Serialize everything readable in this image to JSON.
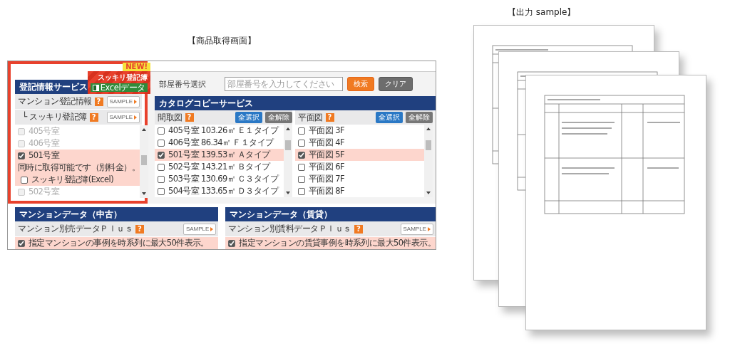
{
  "screen_caption": "【商品取得画面】",
  "output_caption": "【出力 sample】",
  "badge": {
    "new": "NEW!",
    "title": "スッキリ登記簿",
    "tag": "Excelデータ"
  },
  "registry": {
    "title": "登記情報サービス",
    "services": [
      {
        "label": "マンション登記情報",
        "help": "?",
        "sample": "SAMPLE"
      },
      {
        "label": "└ スッキリ登記簿",
        "help": "?",
        "sample": "SAMPLE"
      }
    ],
    "rooms": [
      {
        "kind": "room",
        "label": "405号室",
        "checked": false,
        "disabled": true
      },
      {
        "kind": "room",
        "label": "406号室",
        "checked": false,
        "disabled": true
      },
      {
        "kind": "room",
        "label": "501号室",
        "checked": true,
        "disabled": false
      },
      {
        "kind": "note",
        "label": "同時に取得可能です（別料金）。"
      },
      {
        "kind": "option",
        "label": "スッキリ登記簿(Excel)",
        "checked": false,
        "disabled": false
      },
      {
        "kind": "room",
        "label": "502号室",
        "checked": false,
        "disabled": true
      }
    ]
  },
  "room_search": {
    "label": "部屋番号選択",
    "placeholder": "部屋番号を入力してください",
    "buttons": [
      {
        "kind": "primary",
        "label": "検索"
      },
      {
        "kind": "secondary",
        "label": "クリア"
      }
    ]
  },
  "catalog": {
    "title": "カタログコピーサービス",
    "columns": [
      {
        "title": "間取図",
        "help": "?",
        "select_all": "全選択",
        "clear_all": "全解除",
        "items": [
          {
            "label": "405号室 103.26㎡ Ｅ１タイプ",
            "checked": false
          },
          {
            "label": "406号室 86.34㎡ Ｆ１タイプ",
            "checked": false
          },
          {
            "label": "501号室 139.53㎡ Ａタイプ",
            "checked": true
          },
          {
            "label": "502号室 143.21㎡ Ｂタイプ",
            "checked": false
          },
          {
            "label": "503号室 130.69㎡ Ｃ３タイプ",
            "checked": false
          },
          {
            "label": "504号室 133.65㎡ Ｄ３タイプ",
            "checked": false
          }
        ]
      },
      {
        "title": "平面図",
        "help": "?",
        "select_all": "全選択",
        "clear_all": "全解除",
        "items": [
          {
            "label": "平面図 3F",
            "checked": false
          },
          {
            "label": "平面図 4F",
            "checked": false
          },
          {
            "label": "平面図 5F",
            "checked": true
          },
          {
            "label": "平面図 6F",
            "checked": false
          },
          {
            "label": "平面図 7F",
            "checked": false
          },
          {
            "label": "平面図 8F",
            "checked": false
          }
        ]
      }
    ]
  },
  "mansion_data": [
    {
      "title": "マンションデータ（中古）",
      "product": "マンション別売データＰｌｕｓ",
      "help": "?",
      "sample": "SAMPLE",
      "option": {
        "label": "指定マンションの事例を時系列に最大50件表示。",
        "checked": true
      }
    },
    {
      "title": "マンションデータ（賃貸）",
      "product": "マンション別賃料データＰｌｕｓ",
      "help": "?",
      "sample": "SAMPLE",
      "option": {
        "label": "指定マンションの賃貸事例を時系列に最大50件表示。",
        "checked": true
      }
    }
  ]
}
